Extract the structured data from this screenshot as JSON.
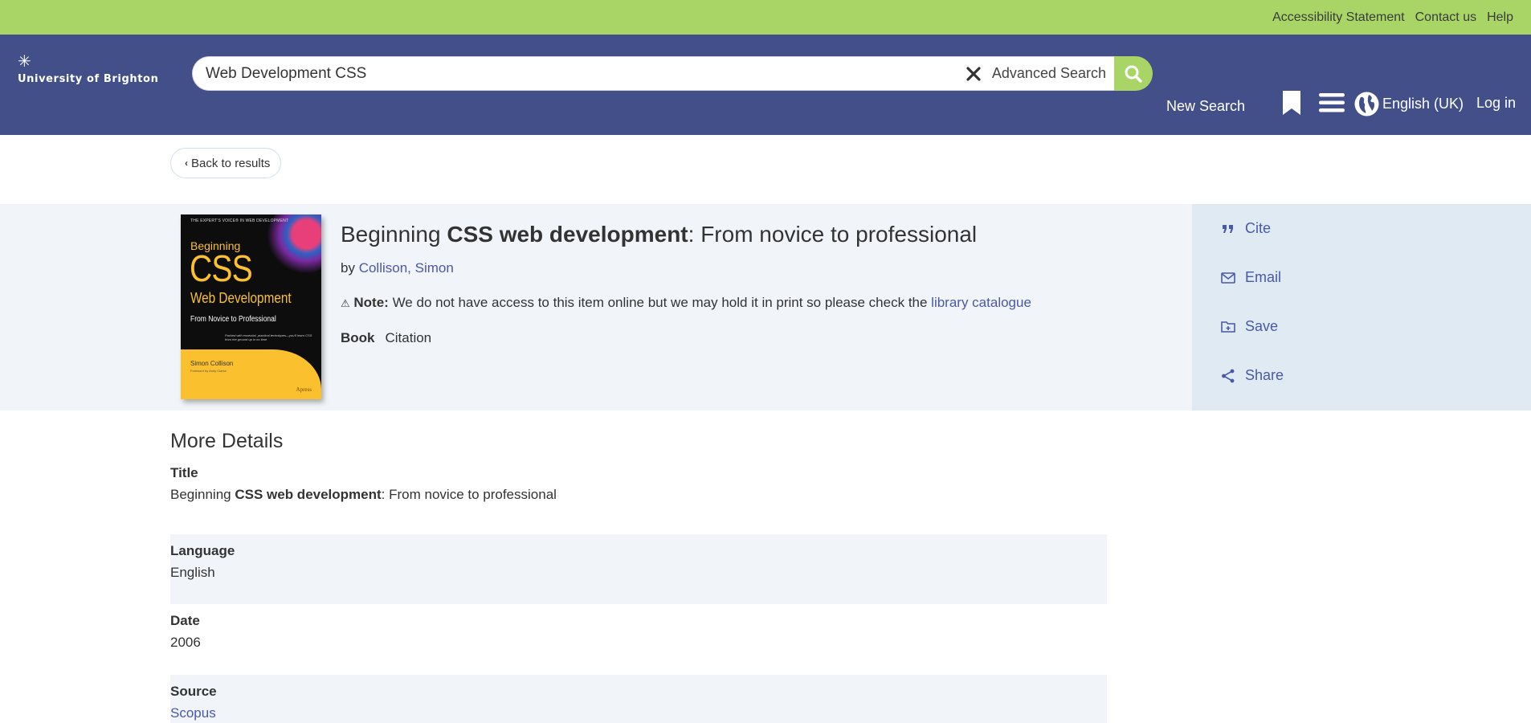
{
  "utility_links": [
    "Accessibility Statement",
    "Contact us",
    "Help"
  ],
  "header": {
    "logo_text": "University of Brighton",
    "search_value": "Web Development CSS",
    "advanced_search": "Advanced Search",
    "new_search": "New Search",
    "language": "English (UK)",
    "login": "Log in"
  },
  "back_label": "Back to results",
  "item": {
    "title_pre": "Beginning ",
    "title_bold": "CSS web development",
    "title_post": ": From novice to professional",
    "by_label": "by",
    "author": "Collison, Simon",
    "note_label": "Note:",
    "note_text": " We do not have access to this item online but we may hold it in print so please check the ",
    "note_link": "library catalogue",
    "type": "Book",
    "citation": "Citation",
    "cover": {
      "series": "THE EXPERT'S VOICE® IN WEB DEVELOPMENT",
      "line1": "Beginning",
      "line2": "CSS",
      "line3": "Web Development",
      "line4": "From Novice to Professional",
      "blurb": "Packed with essential, practical techniques—you'll learn CSS from the ground up in no time",
      "author": "Simon Collison",
      "foreword": "Foreword by Andy Clarke",
      "publisher": "Apress"
    }
  },
  "actions": [
    {
      "label": "Cite",
      "icon": "quote-icon"
    },
    {
      "label": "Email",
      "icon": "envelope-icon"
    },
    {
      "label": "Save",
      "icon": "folder-plus-icon"
    },
    {
      "label": "Share",
      "icon": "share-icon"
    }
  ],
  "details": {
    "heading": "More Details",
    "rows": [
      {
        "label": "Title",
        "value_pre": "Beginning ",
        "value_bold": "CSS web development",
        "value_post": ": From novice to professional"
      },
      {
        "label": "Language",
        "value": "English"
      },
      {
        "label": "Date",
        "value": "2006"
      },
      {
        "label": "Source",
        "value": "Scopus"
      }
    ]
  },
  "colors": {
    "utility_green": "#a9d567",
    "header_purple": "#424f89",
    "link_blue": "#4a58a8",
    "band_light": "#f1f5f9",
    "actions_panel": "#e0eaf3"
  }
}
